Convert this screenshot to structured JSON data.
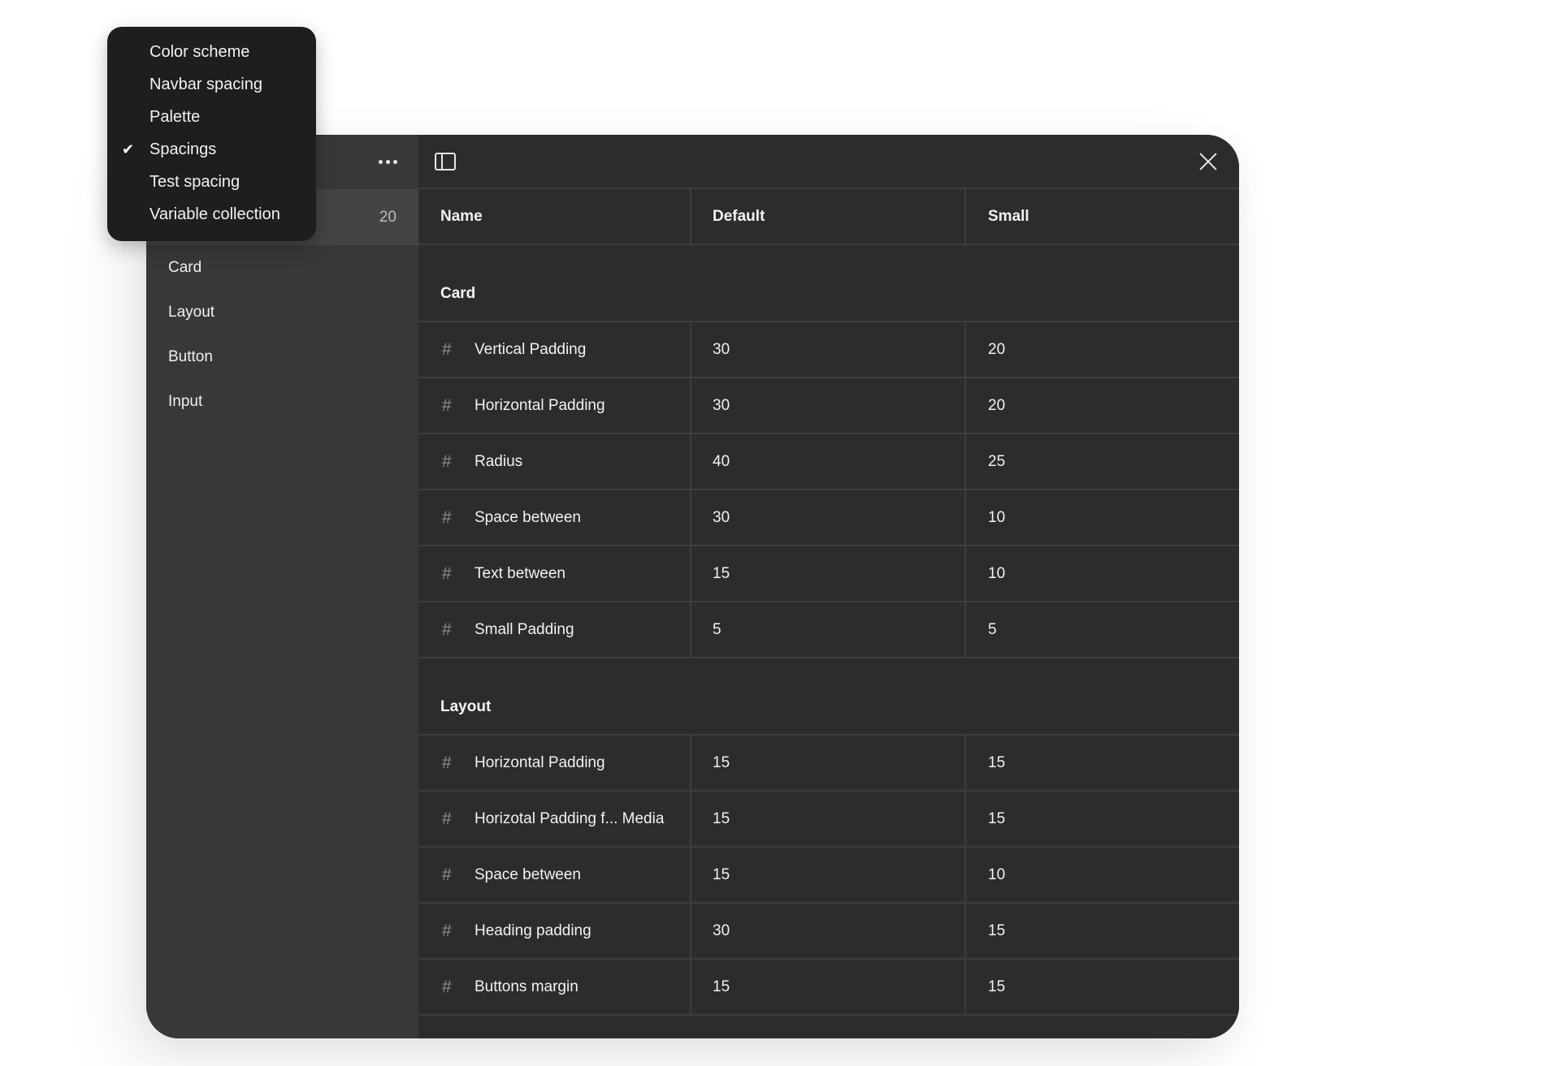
{
  "collections_menu": {
    "items": [
      {
        "label": "Color scheme",
        "selected": false
      },
      {
        "label": "Navbar spacing",
        "selected": false
      },
      {
        "label": "Palette",
        "selected": false
      },
      {
        "label": "Spacings",
        "selected": true
      },
      {
        "label": "Test spacing",
        "selected": false
      },
      {
        "label": "Variable collection",
        "selected": false
      }
    ],
    "check_glyph": "✔"
  },
  "sidebar": {
    "more_icon": "more-horizontal-icon",
    "all_count": "20",
    "groups": [
      {
        "label": "Card"
      },
      {
        "label": "Layout"
      },
      {
        "label": "Button"
      },
      {
        "label": "Input"
      }
    ]
  },
  "toolbar": {
    "toggle_icon": "sidebar-toggle-icon",
    "close_icon": "close-icon"
  },
  "table": {
    "columns": [
      "Name",
      "Default",
      "Small"
    ],
    "hash_glyph": "#",
    "groups": [
      {
        "name": "Card",
        "rows": [
          {
            "name": "Vertical Padding",
            "default": "30",
            "small": "20"
          },
          {
            "name": "Horizontal Padding",
            "default": "30",
            "small": "20"
          },
          {
            "name": "Radius",
            "default": "40",
            "small": "25"
          },
          {
            "name": "Space between",
            "default": "30",
            "small": "10"
          },
          {
            "name": "Text between",
            "default": "15",
            "small": "10"
          },
          {
            "name": "Small Padding",
            "default": "5",
            "small": "5"
          }
        ]
      },
      {
        "name": "Layout",
        "rows": [
          {
            "name": "Horizontal Padding",
            "default": "15",
            "small": "15"
          },
          {
            "name": "Horizotal Padding f... Media",
            "default": "15",
            "small": "15"
          },
          {
            "name": "Space between",
            "default": "15",
            "small": "10"
          },
          {
            "name": "Heading padding",
            "default": "30",
            "small": "15"
          },
          {
            "name": "Buttons margin",
            "default": "15",
            "small": "15"
          }
        ]
      }
    ]
  }
}
